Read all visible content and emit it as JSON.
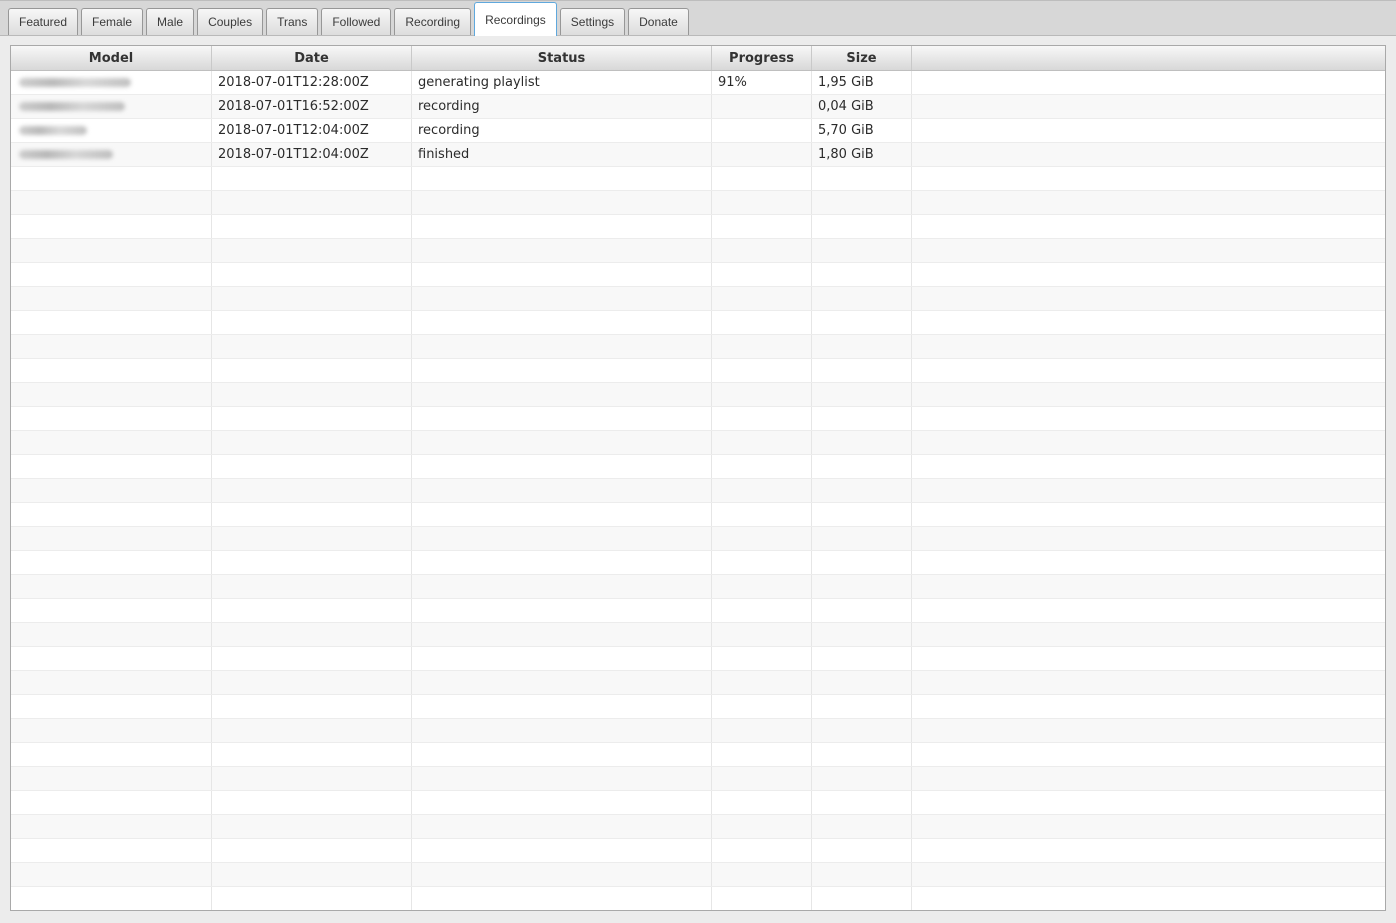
{
  "tabs": [
    {
      "label": "Featured",
      "active": false
    },
    {
      "label": "Female",
      "active": false
    },
    {
      "label": "Male",
      "active": false
    },
    {
      "label": "Couples",
      "active": false
    },
    {
      "label": "Trans",
      "active": false
    },
    {
      "label": "Followed",
      "active": false
    },
    {
      "label": "Recording",
      "active": false
    },
    {
      "label": "Recordings",
      "active": true
    },
    {
      "label": "Settings",
      "active": false
    },
    {
      "label": "Donate",
      "active": false
    }
  ],
  "table": {
    "columns": [
      {
        "id": "model",
        "label": "Model"
      },
      {
        "id": "date",
        "label": "Date"
      },
      {
        "id": "status",
        "label": "Status"
      },
      {
        "id": "progress",
        "label": "Progress"
      },
      {
        "id": "size",
        "label": "Size"
      },
      {
        "id": "filler",
        "label": ""
      }
    ],
    "rows": [
      {
        "model_redacted": true,
        "date": "2018-07-01T12:28:00Z",
        "status": "generating playlist",
        "progress": "91%",
        "size": "1,95 GiB"
      },
      {
        "model_redacted": true,
        "date": "2018-07-01T16:52:00Z",
        "status": "recording",
        "progress": "",
        "size": "0,04 GiB"
      },
      {
        "model_redacted": true,
        "date": "2018-07-01T12:04:00Z",
        "status": "recording",
        "progress": "",
        "size": "5,70 GiB"
      },
      {
        "model_redacted": true,
        "date": "2018-07-01T12:04:00Z",
        "status": "finished",
        "progress": "",
        "size": "1,80 GiB"
      }
    ],
    "empty_row_count": 31
  },
  "colors": {
    "page_bg": "#ececec",
    "tabstrip_bg": "#d7d7d7",
    "active_tab_border": "#5fa8dd",
    "active_tab_bg": "#ffffff",
    "header_gradient_top": "#f8f8f8",
    "header_gradient_bottom": "#d8d8d8",
    "row_alt_bg": "#f8f8f8",
    "cell_text": "#2b2b2b",
    "table_border": "#a9a9a9"
  }
}
